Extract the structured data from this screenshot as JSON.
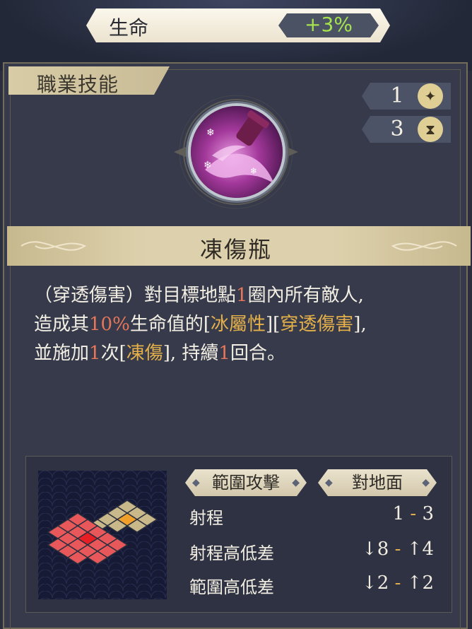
{
  "stat": {
    "label": "生命",
    "value": "+3%"
  },
  "skill": {
    "category": "職業技能",
    "cost": "1",
    "cooldown": "3",
    "cost_icon": "sparkle-icon",
    "cooldown_icon": "hourglass-icon",
    "name": "凍傷瓶",
    "description": {
      "l1_a": "（穿透傷害）對目標地點",
      "l1_num": "1",
      "l1_b": "圈內所有敵人,",
      "l2_a": "造成其",
      "l2_num": "10%",
      "l2_b": "生命值的[",
      "l2_tag1": "冰屬性",
      "l2_c": "][",
      "l2_tag2": "穿透傷害",
      "l2_d": "],",
      "l3_a": "並施加",
      "l3_num": "1",
      "l3_b": "次[",
      "l3_tag": "凍傷",
      "l3_c": "], 持續",
      "l3_num2": "1",
      "l3_d": "回合。"
    }
  },
  "info": {
    "attack_type": "範圍攻擊",
    "target_type": "對地面",
    "range_label": "射程",
    "range_min": "1",
    "range_sep": "-",
    "range_max": "3",
    "range_height_label": "射程高低差",
    "range_height_down": "↓8",
    "range_height_sep": "-",
    "range_height_up": "↑4",
    "area_height_label": "範圍高低差",
    "area_height_down": "↓2",
    "area_height_sep": "-",
    "area_height_up": "↑2"
  },
  "colors": {
    "stat_value": "#a6e34e",
    "highlight_number": "#e5765a",
    "highlight_tag": "#e5b04a",
    "area_tile": "#e8585b",
    "range_tile": "#c9b98a",
    "center_tile": "#e81e25",
    "target_tile": "#f0a02a"
  }
}
